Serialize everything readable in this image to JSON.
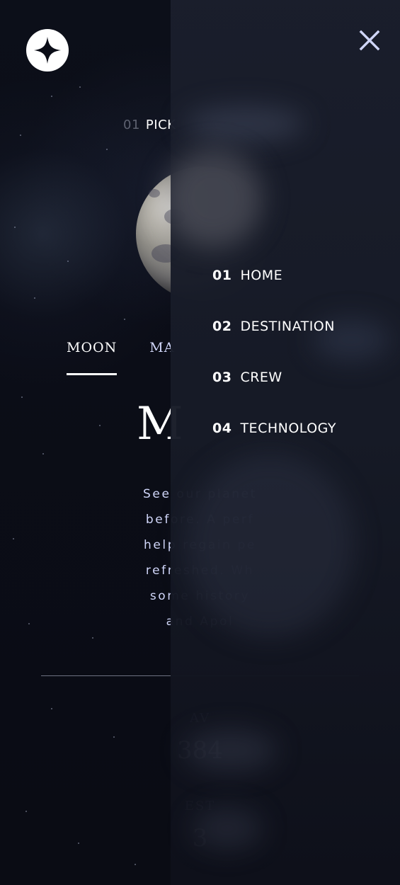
{
  "app": {
    "logo_icon": "four-point-star-icon"
  },
  "header": {
    "page_number": "01",
    "page_title": "PICK"
  },
  "destinations": {
    "tabs": [
      "MOON",
      "MA"
    ],
    "active_tab": "MOON",
    "title": "M",
    "description_lines": [
      "See our planet",
      "before. A perf",
      "help regain pe",
      "refreshed. Wh",
      "some history",
      "and Apol"
    ]
  },
  "stats": {
    "distance_label": "AV",
    "distance_value": "384",
    "travel_label": "EST",
    "travel_value": "3"
  },
  "nav": {
    "close_icon": "close-icon",
    "items": [
      {
        "number": "01",
        "label": "HOME"
      },
      {
        "number": "02",
        "label": "DESTINATION"
      },
      {
        "number": "03",
        "label": "CREW"
      },
      {
        "number": "04",
        "label": "TECHNOLOGY"
      }
    ]
  },
  "colors": {
    "background": "#0b0d17",
    "text_primary": "#ffffff",
    "text_secondary": "#d0d6f9",
    "nav_panel": "#161a26"
  }
}
